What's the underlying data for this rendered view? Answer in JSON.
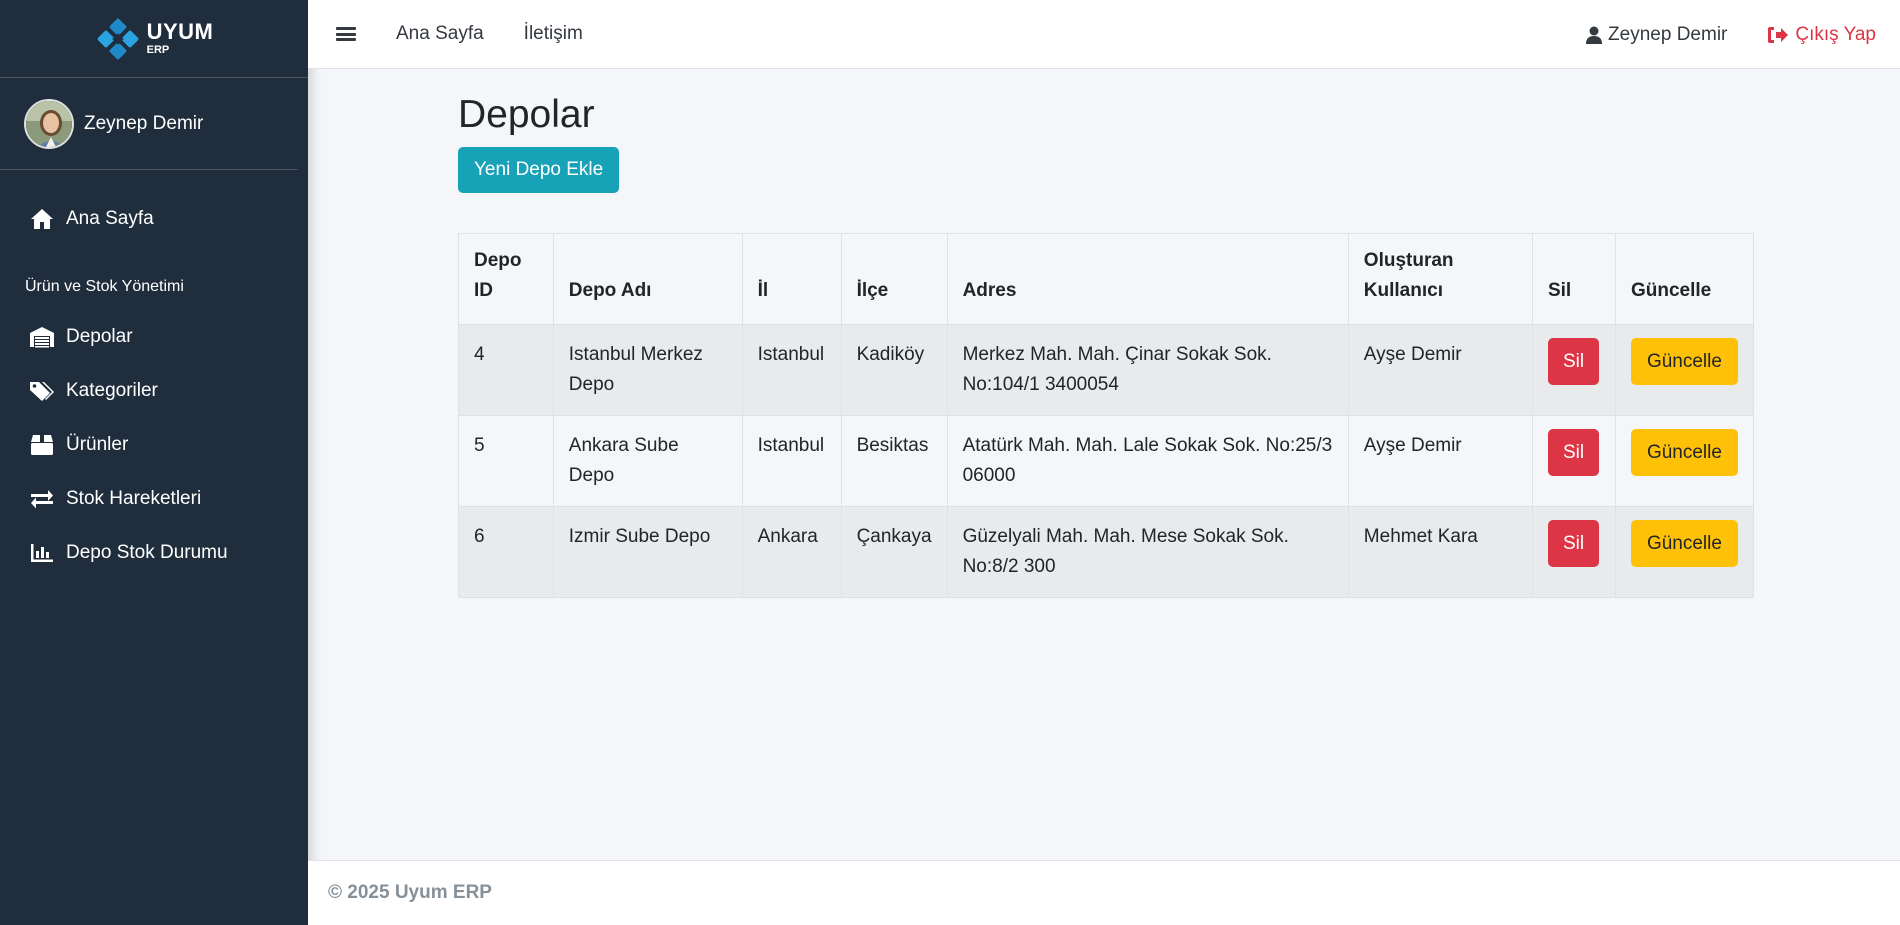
{
  "brand": {
    "name": "UYUM",
    "sub": "ERP"
  },
  "sidebar": {
    "user_name": "Zeynep Demir",
    "home_label": "Ana Sayfa",
    "section_header": "Ürün ve Stok Yönetimi",
    "items": [
      {
        "label": "Depolar",
        "icon": "warehouse-icon"
      },
      {
        "label": "Kategoriler",
        "icon": "tags-icon"
      },
      {
        "label": "Ürünler",
        "icon": "box-icon"
      },
      {
        "label": "Stok Hareketleri",
        "icon": "exchange-icon"
      },
      {
        "label": "Depo Stok Durumu",
        "icon": "bar-chart-icon"
      }
    ]
  },
  "topbar": {
    "links": [
      "Ana Sayfa",
      "İletişim"
    ],
    "user_name": "Zeynep Demir",
    "logout_label": "Çıkış Yap"
  },
  "main": {
    "title": "Depolar",
    "add_button": "Yeni Depo Ekle",
    "table": {
      "headers": [
        "Depo ID",
        "Depo Adı",
        "İl",
        "İlçe",
        "Adres",
        "Oluşturan Kullanıcı",
        "Sil",
        "Güncelle"
      ],
      "rows": [
        {
          "id": "4",
          "name": "Istanbul Merkez Depo",
          "il": "Istanbul",
          "ilce": "Kadiköy",
          "adres": "Merkez Mah. Mah. Çinar Sokak Sok. No:104/1 3400054",
          "user": "Ayşe Demir",
          "sil": "Sil",
          "guncelle": "Güncelle"
        },
        {
          "id": "5",
          "name": "Ankara Sube Depo",
          "il": "Istanbul",
          "ilce": "Besiktas",
          "adres": "Atatürk Mah. Mah. Lale Sokak Sok. No:25/3 06000",
          "user": "Ayşe Demir",
          "sil": "Sil",
          "guncelle": "Güncelle"
        },
        {
          "id": "6",
          "name": "Izmir Sube Depo",
          "il": "Ankara",
          "ilce": "Çankaya",
          "adres": "Güzelyali Mah. Mah. Mese Sokak Sok. No:8/2 300",
          "user": "Mehmet Kara",
          "sil": "Sil",
          "guncelle": "Güncelle"
        }
      ]
    }
  },
  "footer": {
    "text": "© 2025 Uyum ERP"
  },
  "colors": {
    "sidebar_bg": "#1f2d3d",
    "accent": "#17a2b8",
    "danger": "#dc3545",
    "warning": "#ffc107",
    "logo_blue": "#1e88c8"
  }
}
